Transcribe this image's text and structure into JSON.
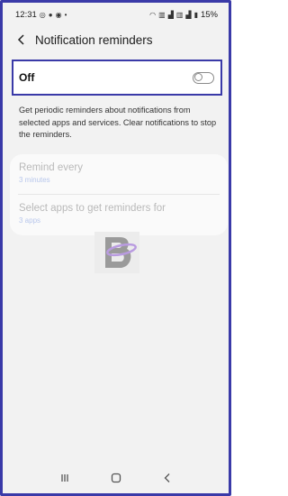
{
  "status_bar": {
    "time": "12:31",
    "battery": "15%"
  },
  "header": {
    "title": "Notification reminders"
  },
  "toggle_card": {
    "label": "Off",
    "enabled": false
  },
  "description": "Get periodic reminders about notifications from selected apps and services. Clear notifications to stop the reminders.",
  "settings": {
    "remind_every": {
      "label": "Remind every",
      "value": "3 minutes"
    },
    "select_apps": {
      "label": "Select apps to get reminders for",
      "value": "3 apps"
    }
  },
  "colors": {
    "frame_border": "#3a3aa8",
    "disabled_text": "#b9b9b9",
    "disabled_subtext": "#b8c7ec"
  }
}
